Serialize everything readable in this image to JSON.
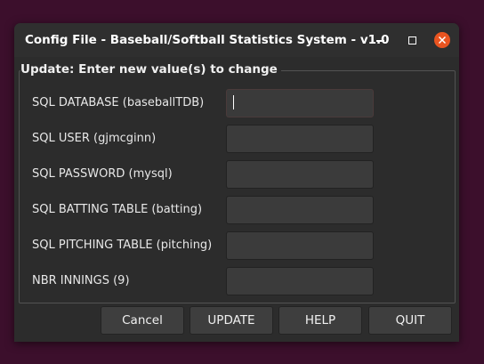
{
  "window": {
    "title": "Config File - Baseball/Softball Statistics System - v1.0"
  },
  "titlebar_buttons": {
    "minimize_icon": "minimize-icon",
    "maximize_icon": "maximize-icon",
    "close_icon": "close-icon",
    "close_color": "#e95420"
  },
  "form": {
    "group_title": "Update: Enter new value(s) to change",
    "fields": [
      {
        "label": "SQL DATABASE (baseballTDB)",
        "value": "",
        "focused": true
      },
      {
        "label": "SQL USER (gjmcginn)",
        "value": ""
      },
      {
        "label": "SQL PASSWORD (mysql)",
        "value": ""
      },
      {
        "label": "SQL BATTING TABLE (batting)",
        "value": ""
      },
      {
        "label": "SQL PITCHING TABLE (pitching)",
        "value": ""
      },
      {
        "label": "NBR INNINGS (9)",
        "value": ""
      }
    ]
  },
  "buttons": {
    "cancel": "Cancel",
    "update": "UPDATE",
    "help": "HELP",
    "quit": "QUIT"
  },
  "colors": {
    "desktop_bg": "#3c0f2c",
    "window_bg": "#2c2c2c",
    "accent": "#e95420"
  }
}
